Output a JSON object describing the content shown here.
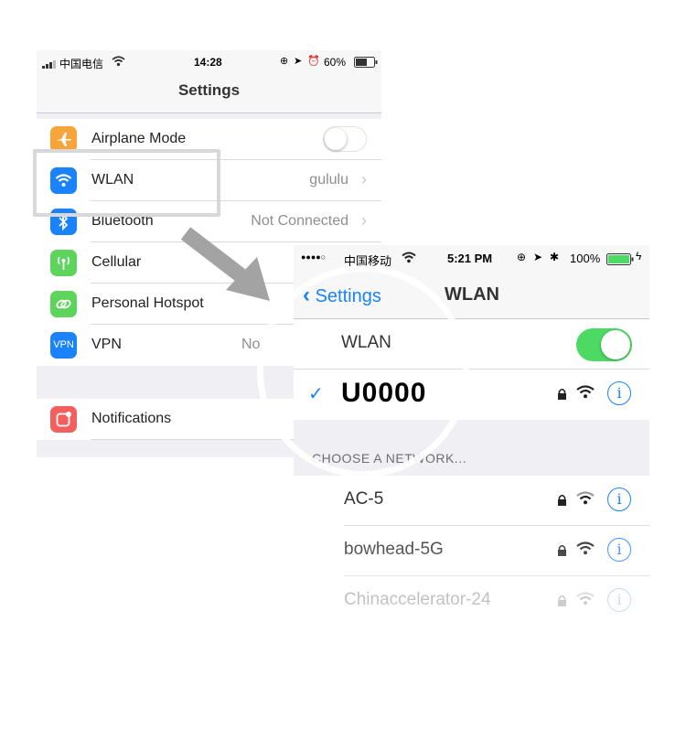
{
  "left_screen": {
    "status": {
      "carrier": "中国电信",
      "time": "14:28",
      "battery": "60%"
    },
    "title": "Settings",
    "rows": [
      {
        "label": "Airplane Mode",
        "value": "",
        "icon": "airplane-icon",
        "color": "#f7a53a"
      },
      {
        "label": "WLAN",
        "value": "gululu",
        "icon": "wifi-icon",
        "color": "#1a82fb"
      },
      {
        "label": "Bluetooth",
        "value": "Not Connected",
        "icon": "bluetooth-icon",
        "color": "#1a82fb"
      },
      {
        "label": "Cellular",
        "value": "",
        "icon": "cellular-icon",
        "color": "#5dd55c"
      },
      {
        "label": "Personal Hotspot",
        "value": "",
        "icon": "hotspot-icon",
        "color": "#5dd55c"
      },
      {
        "label": "VPN",
        "value": "No",
        "icon_text": "VPN",
        "icon": "vpn-icon",
        "color": "#1a82fb"
      },
      {
        "label": "Notifications",
        "value": "",
        "icon": "notifications-icon",
        "color": "#f25f5c"
      }
    ]
  },
  "right_screen": {
    "status": {
      "carrier": "中国移动",
      "time": "5:21 PM",
      "battery": "100%"
    },
    "back_label": "Settings",
    "title": "WLAN",
    "wlan_label": "WLAN",
    "connected": {
      "ssid": "U0000",
      "check": "✓"
    },
    "section_header": "CHOOSE A NETWORK...",
    "networks": [
      {
        "ssid": "AC-5"
      },
      {
        "ssid": "bowhead-5G"
      },
      {
        "ssid": "Chinaccelerator-24"
      }
    ]
  },
  "colors": {
    "ios_blue": "#1a82fb",
    "switch_green": "#4cd964",
    "pointer_arrow": "#a3a3a3"
  }
}
